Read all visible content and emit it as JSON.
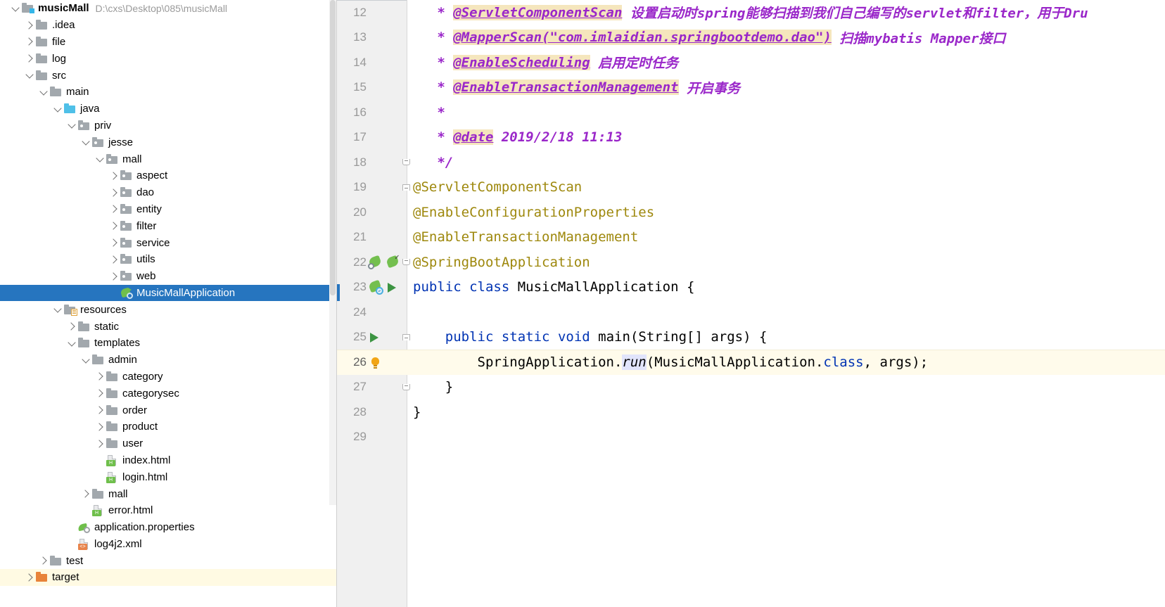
{
  "project_tree": {
    "items": [
      {
        "depth": 0,
        "twisty": "open",
        "icon": "srcroot",
        "label": "musicMall",
        "bold": true,
        "path": "D:\\cxs\\Desktop\\085\\musicMall"
      },
      {
        "depth": 1,
        "twisty": "closed",
        "icon": "folder",
        "label": ".idea"
      },
      {
        "depth": 1,
        "twisty": "closed",
        "icon": "folder",
        "label": "file"
      },
      {
        "depth": 1,
        "twisty": "closed",
        "icon": "folder",
        "label": "log"
      },
      {
        "depth": 1,
        "twisty": "open",
        "icon": "folder",
        "label": "src"
      },
      {
        "depth": 2,
        "twisty": "open",
        "icon": "folder",
        "label": "main"
      },
      {
        "depth": 3,
        "twisty": "open",
        "icon": "folder-blue",
        "label": "java"
      },
      {
        "depth": 4,
        "twisty": "open",
        "icon": "pkg",
        "label": "priv"
      },
      {
        "depth": 5,
        "twisty": "open",
        "icon": "pkg",
        "label": "jesse"
      },
      {
        "depth": 6,
        "twisty": "open",
        "icon": "pkg",
        "label": "mall"
      },
      {
        "depth": 7,
        "twisty": "closed",
        "icon": "pkg",
        "label": "aspect"
      },
      {
        "depth": 7,
        "twisty": "closed",
        "icon": "pkg",
        "label": "dao"
      },
      {
        "depth": 7,
        "twisty": "closed",
        "icon": "pkg",
        "label": "entity"
      },
      {
        "depth": 7,
        "twisty": "closed",
        "icon": "pkg",
        "label": "filter"
      },
      {
        "depth": 7,
        "twisty": "closed",
        "icon": "pkg",
        "label": "service"
      },
      {
        "depth": 7,
        "twisty": "closed",
        "icon": "pkg",
        "label": "utils"
      },
      {
        "depth": 7,
        "twisty": "closed",
        "icon": "pkg",
        "label": "web"
      },
      {
        "depth": 7,
        "twisty": "none",
        "icon": "springclass",
        "label": "MusicMallApplication",
        "selected": true
      },
      {
        "depth": 3,
        "twisty": "open",
        "icon": "resroot",
        "label": "resources"
      },
      {
        "depth": 4,
        "twisty": "closed",
        "icon": "folder",
        "label": "static"
      },
      {
        "depth": 4,
        "twisty": "open",
        "icon": "folder",
        "label": "templates"
      },
      {
        "depth": 5,
        "twisty": "open",
        "icon": "folder",
        "label": "admin"
      },
      {
        "depth": 6,
        "twisty": "closed",
        "icon": "folder",
        "label": "category"
      },
      {
        "depth": 6,
        "twisty": "closed",
        "icon": "folder",
        "label": "categorysec"
      },
      {
        "depth": 6,
        "twisty": "closed",
        "icon": "folder",
        "label": "order"
      },
      {
        "depth": 6,
        "twisty": "closed",
        "icon": "folder",
        "label": "product"
      },
      {
        "depth": 6,
        "twisty": "closed",
        "icon": "folder",
        "label": "user"
      },
      {
        "depth": 6,
        "twisty": "none",
        "icon": "file-html",
        "label": "index.html"
      },
      {
        "depth": 6,
        "twisty": "none",
        "icon": "file-html",
        "label": "login.html"
      },
      {
        "depth": 5,
        "twisty": "closed",
        "icon": "folder",
        "label": "mall"
      },
      {
        "depth": 5,
        "twisty": "none",
        "icon": "file-html",
        "label": "error.html"
      },
      {
        "depth": 4,
        "twisty": "none",
        "icon": "spring",
        "label": "application.properties"
      },
      {
        "depth": 4,
        "twisty": "none",
        "icon": "file-xml",
        "label": "log4j2.xml"
      },
      {
        "depth": 2,
        "twisty": "closed",
        "icon": "folder",
        "label": "test"
      },
      {
        "depth": 1,
        "twisty": "closed",
        "icon": "folder-orange",
        "label": "target",
        "marked": true
      }
    ]
  },
  "editor": {
    "lines": [
      {
        "no": "12",
        "fold": "",
        "gicons": [],
        "tokens": [
          {
            "t": "   * ",
            "c": "cm"
          },
          {
            "t": "@ServletComponentScan",
            "c": "cm-tag"
          },
          {
            "t": " 设置启动时spring能够扫描到我们自己编写的servlet和filter，用于Dru",
            "c": "cm"
          }
        ]
      },
      {
        "no": "13",
        "fold": "",
        "gicons": [],
        "tokens": [
          {
            "t": "   * ",
            "c": "cm"
          },
          {
            "t": "@MapperScan(\"com.imlaidian.springbootdemo.dao\")",
            "c": "cm-tag"
          },
          {
            "t": " 扫描mybatis Mapper接口",
            "c": "cm"
          }
        ]
      },
      {
        "no": "14",
        "fold": "",
        "gicons": [],
        "tokens": [
          {
            "t": "   * ",
            "c": "cm"
          },
          {
            "t": "@EnableScheduling",
            "c": "cm-tag"
          },
          {
            "t": " 启用定时任务",
            "c": "cm"
          }
        ]
      },
      {
        "no": "15",
        "fold": "",
        "gicons": [],
        "tokens": [
          {
            "t": "   * ",
            "c": "cm"
          },
          {
            "t": "@EnableTransactionManagement",
            "c": "cm-tag"
          },
          {
            "t": " 开启事务",
            "c": "cm"
          }
        ]
      },
      {
        "no": "16",
        "fold": "",
        "gicons": [],
        "tokens": [
          {
            "t": "   *",
            "c": "cm"
          }
        ]
      },
      {
        "no": "17",
        "fold": "",
        "gicons": [],
        "tokens": [
          {
            "t": "   * ",
            "c": "cm"
          },
          {
            "t": "@date",
            "c": "cm-tag"
          },
          {
            "t": " 2019/2/18 11:13",
            "c": "cm"
          }
        ]
      },
      {
        "no": "18",
        "fold": "bottom",
        "gicons": [],
        "tokens": [
          {
            "t": "   */",
            "c": "cm"
          }
        ]
      },
      {
        "no": "19",
        "fold": "top",
        "gicons": [],
        "tokens": [
          {
            "t": "@ServletComponentScan",
            "c": "anno"
          }
        ]
      },
      {
        "no": "20",
        "fold": "",
        "gicons": [],
        "tokens": [
          {
            "t": "@EnableConfigurationProperties",
            "c": "anno"
          }
        ]
      },
      {
        "no": "21",
        "fold": "",
        "gicons": [],
        "tokens": [
          {
            "t": "@EnableTransactionManagement",
            "c": "anno"
          }
        ]
      },
      {
        "no": "22",
        "fold": "bottom",
        "gicons": [
          "spring-search",
          "spring-check"
        ],
        "tokens": [
          {
            "t": "@SpringBootApplication",
            "c": "anno"
          }
        ]
      },
      {
        "no": "23",
        "fold": "",
        "gicons": [
          "spring-cycle",
          "run"
        ],
        "selected": true,
        "tokens": [
          {
            "t": "public",
            "c": "kw"
          },
          {
            "t": " ",
            "c": "plain"
          },
          {
            "t": "class",
            "c": "kw"
          },
          {
            "t": " MusicMallApplication {",
            "c": "plain"
          }
        ]
      },
      {
        "no": "24",
        "fold": "",
        "gicons": [],
        "tokens": []
      },
      {
        "no": "25",
        "fold": "top",
        "gicons": [
          "run"
        ],
        "tokens": [
          {
            "t": "    ",
            "c": "plain"
          },
          {
            "t": "public",
            "c": "kw"
          },
          {
            "t": " ",
            "c": "plain"
          },
          {
            "t": "static",
            "c": "kw"
          },
          {
            "t": " ",
            "c": "plain"
          },
          {
            "t": "void",
            "c": "kw"
          },
          {
            "t": " ",
            "c": "plain"
          },
          {
            "t": "main",
            "c": "ident"
          },
          {
            "t": "(String[] args) {",
            "c": "plain"
          }
        ]
      },
      {
        "no": "26",
        "fold": "",
        "gicons": [
          "bulb"
        ],
        "caret": true,
        "tokens": [
          {
            "t": "        SpringApplication.",
            "c": "plain"
          },
          {
            "t": "run",
            "c": "mth"
          },
          {
            "t": "(MusicMallApplication.",
            "c": "plain"
          },
          {
            "t": "class",
            "c": "kw"
          },
          {
            "t": ", args);",
            "c": "plain"
          }
        ]
      },
      {
        "no": "27",
        "fold": "bottom",
        "gicons": [],
        "tokens": [
          {
            "t": "    }",
            "c": "plain"
          }
        ]
      },
      {
        "no": "28",
        "fold": "",
        "gicons": [],
        "tokens": [
          {
            "t": "}",
            "c": "plain"
          }
        ]
      },
      {
        "no": "29",
        "fold": "",
        "gicons": [],
        "tokens": []
      }
    ]
  }
}
